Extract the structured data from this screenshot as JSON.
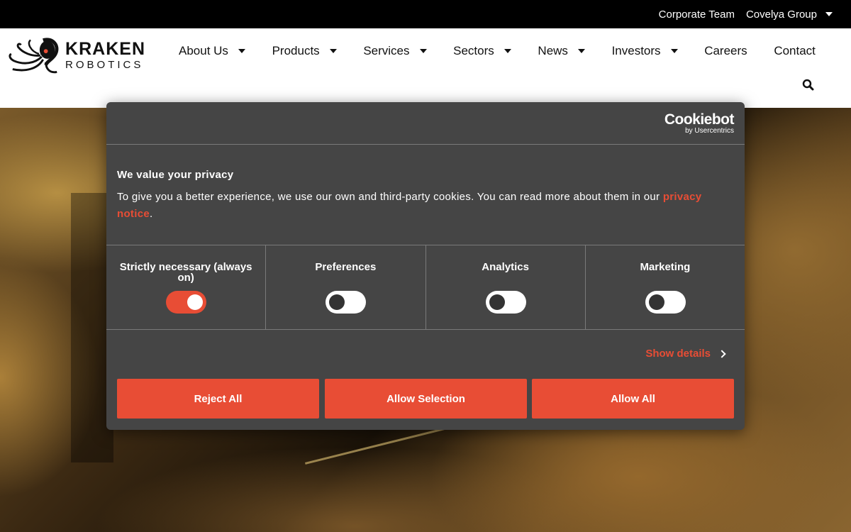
{
  "topbar": {
    "corporate_team": "Corporate Team",
    "covelya_group": "Covelya Group"
  },
  "logo": {
    "line1": "KRAKEN",
    "line2": "ROBOTICS"
  },
  "nav": {
    "items": [
      {
        "label": "About Us",
        "has_dropdown": true
      },
      {
        "label": "Products",
        "has_dropdown": true
      },
      {
        "label": "Services",
        "has_dropdown": true
      },
      {
        "label": "Sectors",
        "has_dropdown": true
      },
      {
        "label": "News",
        "has_dropdown": true
      },
      {
        "label": "Investors",
        "has_dropdown": true
      },
      {
        "label": "Careers",
        "has_dropdown": false
      },
      {
        "label": "Contact",
        "has_dropdown": false
      }
    ],
    "search_icon": "search-icon"
  },
  "cookie_dialog": {
    "brand": "Cookiebot",
    "brand_sub": "by Usercentrics",
    "title": "We value your privacy",
    "text": "To give you a better experience, we use our own and third-party cookies. You can read more about them in our ",
    "link_text": "privacy notice",
    "text_end": ".",
    "categories": [
      {
        "label": "Strictly necessary (always on)",
        "enabled": true
      },
      {
        "label": "Preferences",
        "enabled": false
      },
      {
        "label": "Analytics",
        "enabled": false
      },
      {
        "label": "Marketing",
        "enabled": false
      }
    ],
    "show_details": "Show details",
    "buttons": {
      "reject": "Reject All",
      "allow_selection": "Allow Selection",
      "allow_all": "Allow All"
    }
  },
  "colors": {
    "accent": "#e84d35",
    "dialog_bg": "#454545",
    "topbar_bg": "#000000"
  }
}
